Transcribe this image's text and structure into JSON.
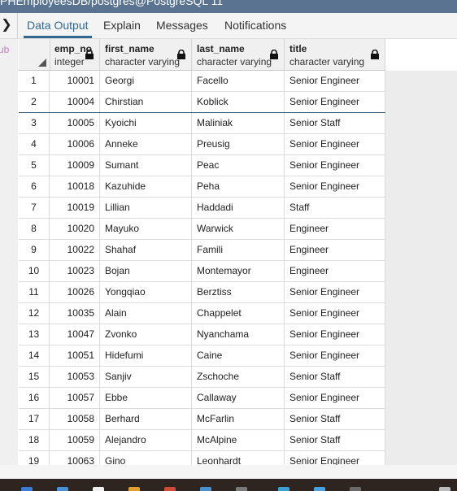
{
  "window": {
    "title": "PHEmployeesDB/postgres@PostgreSQL 11"
  },
  "tabs": [
    {
      "label": "Data Output",
      "active": true
    },
    {
      "label": "Explain",
      "active": false
    },
    {
      "label": "Messages",
      "active": false
    },
    {
      "label": "Notifications",
      "active": false
    }
  ],
  "left_stub_text": "ub",
  "columns": [
    {
      "name": "emp_no",
      "type": "integer"
    },
    {
      "name": "first_name",
      "type": "character varying"
    },
    {
      "name": "last_name",
      "type": "character varying"
    },
    {
      "name": "title",
      "type": "character varying"
    }
  ],
  "selected_row": 2,
  "rows": [
    {
      "n": "1",
      "emp_no": "10001",
      "first_name": "Georgi",
      "last_name": "Facello",
      "title": "Senior Engineer"
    },
    {
      "n": "2",
      "emp_no": "10004",
      "first_name": "Chirstian",
      "last_name": "Koblick",
      "title": "Senior Engineer"
    },
    {
      "n": "3",
      "emp_no": "10005",
      "first_name": "Kyoichi",
      "last_name": "Maliniak",
      "title": "Senior Staff"
    },
    {
      "n": "4",
      "emp_no": "10006",
      "first_name": "Anneke",
      "last_name": "Preusig",
      "title": "Senior Engineer"
    },
    {
      "n": "5",
      "emp_no": "10009",
      "first_name": "Sumant",
      "last_name": "Peac",
      "title": "Senior Engineer"
    },
    {
      "n": "6",
      "emp_no": "10018",
      "first_name": "Kazuhide",
      "last_name": "Peha",
      "title": "Senior Engineer"
    },
    {
      "n": "7",
      "emp_no": "10019",
      "first_name": "Lillian",
      "last_name": "Haddadi",
      "title": "Staff"
    },
    {
      "n": "8",
      "emp_no": "10020",
      "first_name": "Mayuko",
      "last_name": "Warwick",
      "title": "Engineer"
    },
    {
      "n": "9",
      "emp_no": "10022",
      "first_name": "Shahaf",
      "last_name": "Famili",
      "title": "Engineer"
    },
    {
      "n": "10",
      "emp_no": "10023",
      "first_name": "Bojan",
      "last_name": "Montemayor",
      "title": "Engineer"
    },
    {
      "n": "11",
      "emp_no": "10026",
      "first_name": "Yongqiao",
      "last_name": "Berztiss",
      "title": "Senior Engineer"
    },
    {
      "n": "12",
      "emp_no": "10035",
      "first_name": "Alain",
      "last_name": "Chappelet",
      "title": "Senior Engineer"
    },
    {
      "n": "13",
      "emp_no": "10047",
      "first_name": "Zvonko",
      "last_name": "Nyanchama",
      "title": "Senior Engineer"
    },
    {
      "n": "14",
      "emp_no": "10051",
      "first_name": "Hidefumi",
      "last_name": "Caine",
      "title": "Senior Engineer"
    },
    {
      "n": "15",
      "emp_no": "10053",
      "first_name": "Sanjiv",
      "last_name": "Zschoche",
      "title": "Senior Staff"
    },
    {
      "n": "16",
      "emp_no": "10057",
      "first_name": "Ebbe",
      "last_name": "Callaway",
      "title": "Senior Engineer"
    },
    {
      "n": "17",
      "emp_no": "10058",
      "first_name": "Berhard",
      "last_name": "McFarlin",
      "title": "Senior Staff"
    },
    {
      "n": "18",
      "emp_no": "10059",
      "first_name": "Alejandro",
      "last_name": "McAlpine",
      "title": "Senior Staff"
    },
    {
      "n": "19",
      "emp_no": "10063",
      "first_name": "Gino",
      "last_name": "Leonhardt",
      "title": "Senior Engineer"
    }
  ],
  "colors": {
    "accent": "#326690",
    "titlebar": "#5a7391",
    "taskbar": "#2f2520"
  },
  "icons": [
    "chevron-right-icon",
    "lock-icon",
    "sort-corner-icon"
  ]
}
